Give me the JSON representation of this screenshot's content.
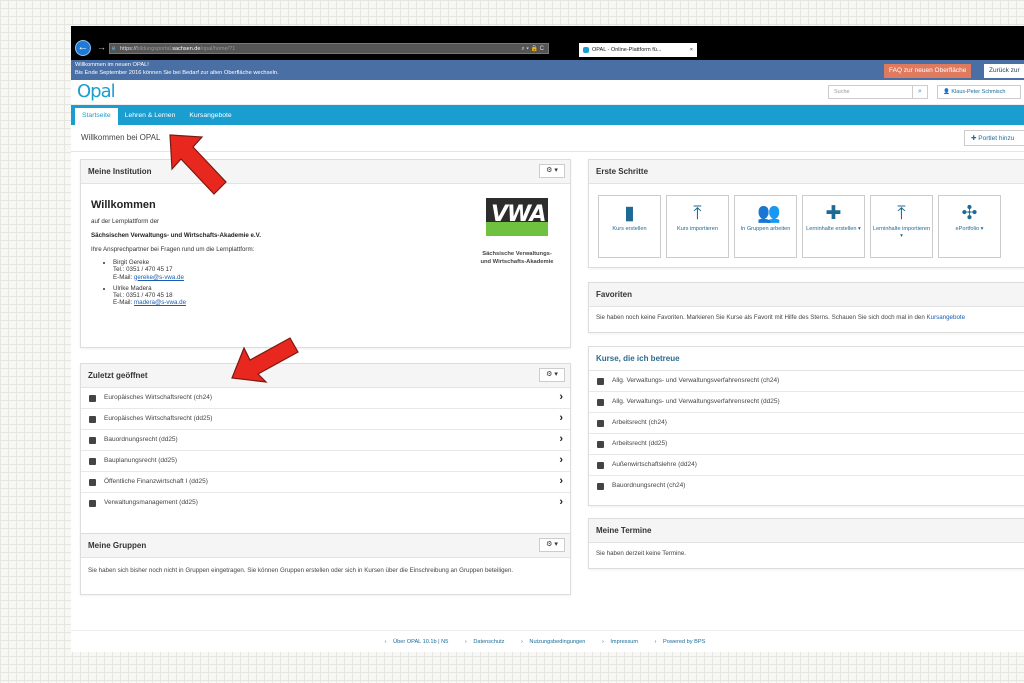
{
  "browser": {
    "url_scheme": "https://",
    "url_dim1": "bildungsportal.",
    "url_domain": "sachsen.de",
    "url_path": "/opal/home/?1",
    "addr_controls": "⌕ ▾ 🔒 C",
    "tab_title": "OPAL - Online-Plattform fü...",
    "tab_close": "×"
  },
  "notice": {
    "line1": "Willkommen im neuen OPAL!",
    "line2": "Bis Ende September 2016 können Sie bei Bedarf zur alten Oberfläche wechseln.",
    "faq_button": "FAQ zur neuen Oberfläche",
    "back_button": "Zurück zur"
  },
  "header": {
    "logo": "Opal",
    "search_placeholder": "Suche",
    "user_name": "Klaus-Peter Schmisch"
  },
  "nav": {
    "items": [
      "Startseite",
      "Lehren & Lernen",
      "Kursangebote"
    ]
  },
  "welcome": {
    "title": "Willkommen bei OPAL",
    "add_portlet": "Portlet hinzu"
  },
  "institution": {
    "title": "Meine Institution",
    "gear": "⚙ ▾",
    "heading": "Willkommen",
    "line1": "auf der Lernplattform der",
    "line2": "Sächsischen Verwaltungs- und Wirtschafts-Akademie e.V.",
    "line3": "Ihre Ansprechpartner bei Fragen rund um die Lernplattform:",
    "contacts": [
      {
        "name": "Birgit Gereke",
        "tel": "Tel.: 0351 / 470 45 17",
        "email_label": "E-Mail: ",
        "email": "gereke@s-vwa.de"
      },
      {
        "name": "Ulrike Madera",
        "tel": "Tel.: 0351 / 470 45 18",
        "email_label": "E-Mail: ",
        "email": "madera@s-vwa.de"
      }
    ],
    "logo_text": "VWA",
    "logo_caption1": "Sächsische Verwaltungs-",
    "logo_caption2": "und Wirtschafts-Akademie"
  },
  "recent": {
    "title": "Zuletzt geöffnet",
    "gear": "⚙ ▾",
    "items": [
      "Europäisches Wirtschaftsrecht (ch24)",
      "Europäisches Wirtschaftsrecht (dd25)",
      "Bauordnungsrecht (dd25)",
      "Bauplanungsrecht (dd25)",
      "Öffentliche Finanzwirtschaft I (dd25)",
      "Verwaltungsmanagement (dd25)"
    ]
  },
  "groups": {
    "title": "Meine Gruppen",
    "gear": "⚙ ▾",
    "text": "Sie haben sich bisher noch nicht in Gruppen eingetragen. Sie können Gruppen erstellen oder sich in Kursen über die Einschreibung an Gruppen beteiligen."
  },
  "first_steps": {
    "title": "Erste Schritte",
    "tiles": [
      {
        "icon": "book-icon",
        "label": "Kurs erstellen",
        "glyph": "▮"
      },
      {
        "icon": "upload-icon",
        "label": "Kurs importieren",
        "glyph": "⤒"
      },
      {
        "icon": "group-icon",
        "label": "In Gruppen arbeiten",
        "glyph": "👥"
      },
      {
        "icon": "plus-icon",
        "label": "Lerninhalte erstellen ▾",
        "glyph": "✚"
      },
      {
        "icon": "upload-icon",
        "label": "Lerninhalte importieren ▾",
        "glyph": "⤒"
      },
      {
        "icon": "puzzle-icon",
        "label": "ePortfolio ▾",
        "glyph": "✣"
      }
    ]
  },
  "favorites": {
    "title": "Favoriten",
    "text": "Sie haben noch keine Favoriten. Markieren Sie Kurse als Favorit mit Hilfe des Sterns. Schauen Sie sich doch mal in den ",
    "link": "Kursangebote"
  },
  "managed": {
    "title": "Kurse, die ich betreue",
    "items": [
      "Allg. Verwaltungs- und Verwaltungsverfahrensrecht (ch24)",
      "Allg. Verwaltungs- und Verwaltungsverfahrensrecht (dd25)",
      "Arbeitsrecht (ch24)",
      "Arbeitsrecht (dd25)",
      "Außenwirtschaftslehre (dd24)",
      "Bauordnungsrecht (ch24)"
    ]
  },
  "appointments": {
    "title": "Meine Termine",
    "text": "Sie haben derzeit keine Termine."
  },
  "footer": {
    "items": [
      "Über OPAL 10.1b | N5",
      "Datenschutz",
      "Nutzungsbedingungen",
      "Impressum",
      "Powered by BPS"
    ]
  },
  "colors": {
    "accent": "#1a9ed0",
    "notice": "#4a6fa5",
    "faq": "#e07a5f",
    "arrow": "#e8271e"
  }
}
